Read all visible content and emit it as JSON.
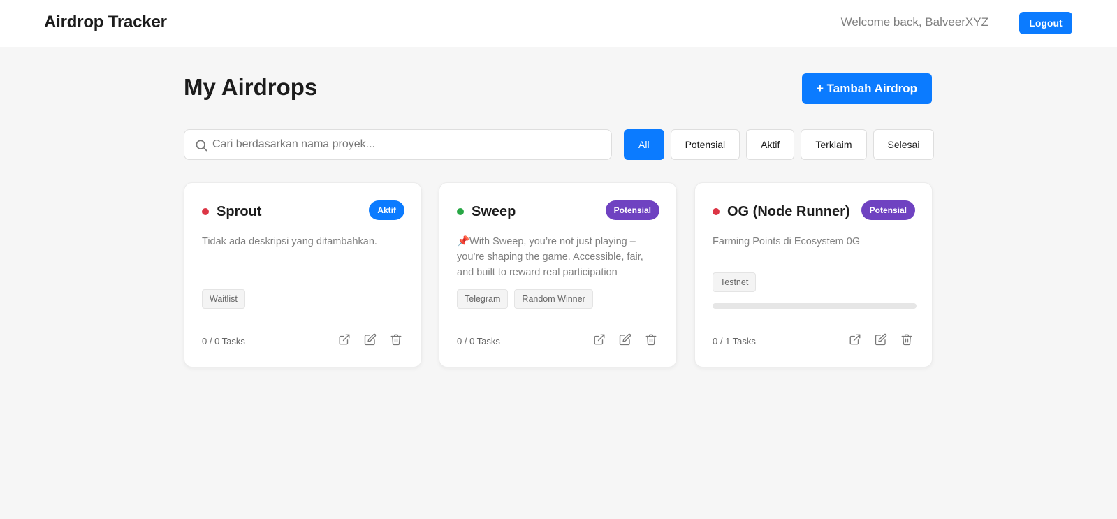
{
  "header": {
    "brand": "Airdrop Tracker",
    "welcome": "Welcome back, BalveerXYZ",
    "logout_label": "Logout"
  },
  "page": {
    "title": "My Airdrops",
    "add_label": "+ Tambah Airdrop"
  },
  "search": {
    "placeholder": "Cari berdasarkan nama proyek...",
    "value": ""
  },
  "filters": [
    {
      "label": "All",
      "active": true
    },
    {
      "label": "Potensial",
      "active": false
    },
    {
      "label": "Aktif",
      "active": false
    },
    {
      "label": "Terklaim",
      "active": false
    },
    {
      "label": "Selesai",
      "active": false
    }
  ],
  "colors": {
    "accent": "#0b7bff",
    "aktif_badge": "#0b7bff",
    "potensial_badge": "#6f42c1",
    "dot_red": "#dc3545",
    "dot_green": "#28a745"
  },
  "cards": [
    {
      "title": "Sprout",
      "dot_color": "#dc3545",
      "badge": "Aktif",
      "badge_color": "#0b7bff",
      "description": "Tidak ada deskripsi yang ditambahkan.",
      "tags": [
        "Waitlist"
      ],
      "tasks": "0 / 0 Tasks",
      "show_progress": false,
      "progress": 0
    },
    {
      "title": "Sweep",
      "dot_color": "#28a745",
      "badge": "Potensial",
      "badge_color": "#6f42c1",
      "description": "📌With Sweep, you’re not just playing – you’re shaping the game. Accessible, fair, and built to reward real participation",
      "tags": [
        "Telegram",
        "Random Winner"
      ],
      "tasks": "0 / 0 Tasks",
      "show_progress": false,
      "progress": 0
    },
    {
      "title": "OG (Node Runner)",
      "dot_color": "#dc3545",
      "badge": "Potensial",
      "badge_color": "#6f42c1",
      "description": "Farming Points di Ecosystem 0G",
      "tags": [
        "Testnet"
      ],
      "tasks": "0 / 1 Tasks",
      "show_progress": true,
      "progress": 0
    }
  ],
  "icons": {
    "search": "search-icon",
    "open": "external-link-icon",
    "edit": "edit-icon",
    "delete": "trash-icon"
  }
}
